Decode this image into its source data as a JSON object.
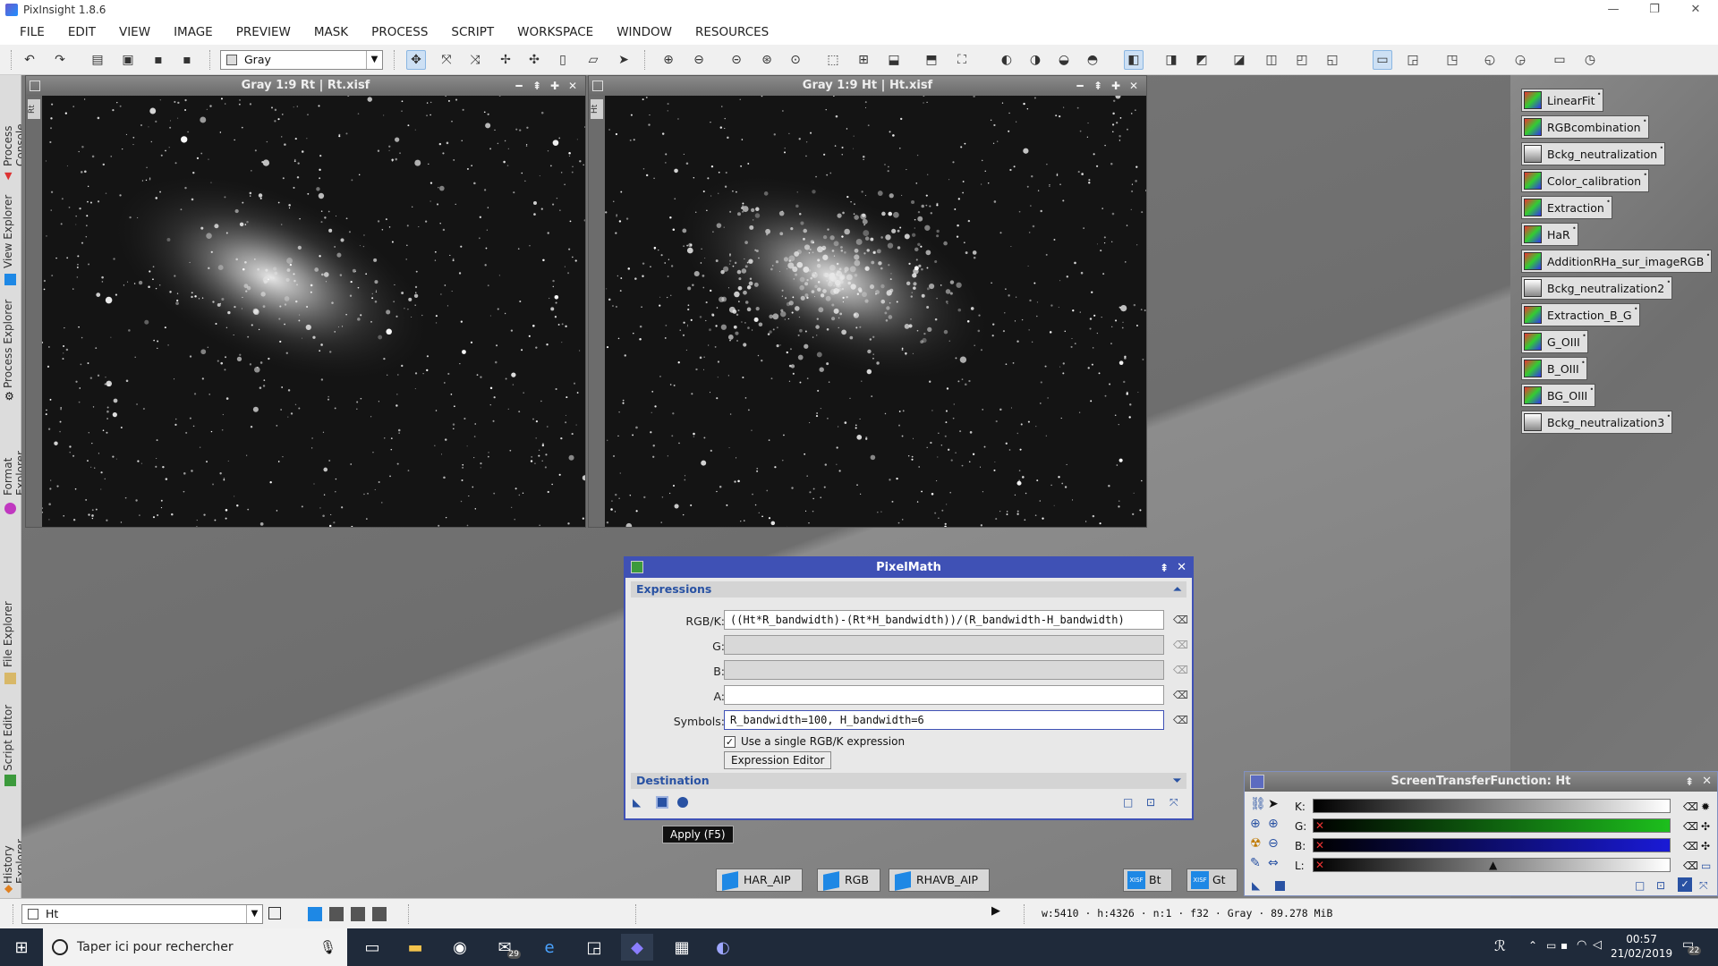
{
  "window": {
    "title": "PixInsight 1.8.6"
  },
  "menu": [
    "FILE",
    "EDIT",
    "VIEW",
    "IMAGE",
    "PREVIEW",
    "MASK",
    "PROCESS",
    "SCRIPT",
    "WORKSPACE",
    "WINDOW",
    "RESOURCES"
  ],
  "toolbar": {
    "image_mode": "Gray"
  },
  "left_tabs": [
    "Process Console",
    "View Explorer",
    "Process Explorer",
    "Format Explorer",
    "File Explorer",
    "Script Editor",
    "History Explorer"
  ],
  "image_windows": [
    {
      "title": "Gray 1:9 Rt | Rt.xisf",
      "tag": "Rt"
    },
    {
      "title": "Gray 1:9 Ht | Ht.xisf",
      "tag": "Ht"
    }
  ],
  "process_icons": [
    "LinearFit",
    "RGBcombination",
    "Bckg_neutralization",
    "Color_calibration",
    "Extraction",
    "HaR",
    "AdditionRHa_sur_imageRGB",
    "Bckg_neutralization2",
    "Extraction_B_G",
    "G_OIII",
    "B_OIII",
    "BG_OIII",
    "Bckg_neutralization3"
  ],
  "pixelmath": {
    "title": "PixelMath",
    "expressions_label": "Expressions",
    "labels": {
      "rgbk": "RGB/K:",
      "g": "G:",
      "b": "B:",
      "a": "A:",
      "symbols": "Symbols:"
    },
    "rgbk_value": "((Ht*R_bandwidth)-(Rt*H_bandwidth))/(R_bandwidth-H_bandwidth)",
    "g_value": "",
    "b_value": "",
    "a_value": "",
    "symbols_value": "R_bandwidth=100, H_bandwidth=6",
    "single_expr_label": "Use a single RGB/K expression",
    "single_expr_checked": true,
    "editor_button": "Expression Editor",
    "destination_label": "Destination",
    "tooltip": "Apply (F5)"
  },
  "stf": {
    "title": "ScreenTransferFunction: Ht",
    "rows": [
      "K:",
      "G:",
      "B:",
      "L:"
    ]
  },
  "shelf_icons": [
    {
      "label": "HAR_AIP"
    },
    {
      "label": "RGB"
    },
    {
      "label": "RHAVB_AIP"
    }
  ],
  "minimized_views": [
    {
      "label": "Bt",
      "tag": "XISF"
    },
    {
      "label": "Gt",
      "tag": "XISF"
    }
  ],
  "bottom": {
    "view_select": "Ht",
    "info": "w:5410  ·  h:4326  ·  n:1  ·  f32  ·  Gray  ·  89.278 MiB"
  },
  "taskbar": {
    "search_placeholder": "Taper ici pour rechercher",
    "time": "00:57",
    "date": "21/02/2019",
    "mail_badge": "29",
    "notif_badge": "22"
  },
  "colors": {
    "accent": "#3f51b5",
    "stf_green": "#1dbf1d",
    "stf_blue": "#1a1ad6",
    "workspace": "#787878"
  }
}
